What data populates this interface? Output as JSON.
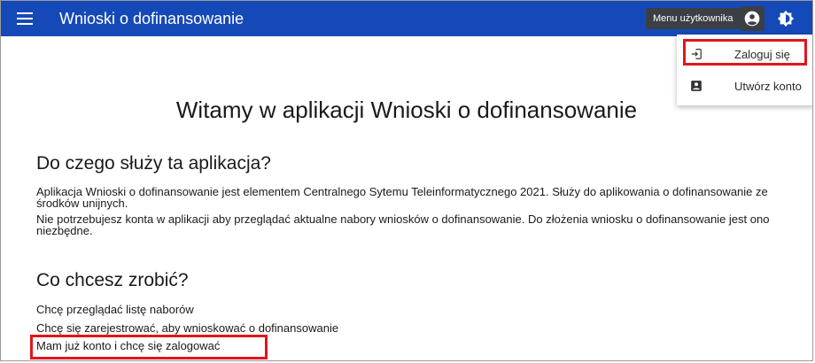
{
  "header": {
    "app_title": "Wnioski o dofinansowanie",
    "user_menu_label": "Menu użytkownika",
    "bar_color": "#1549b8"
  },
  "dropdown": {
    "items": [
      {
        "label": "Zaloguj się",
        "icon": "login-icon"
      },
      {
        "label": "Utwórz konto",
        "icon": "account-box-icon"
      }
    ]
  },
  "main": {
    "welcome": "Witamy w aplikacji Wnioski o dofinansowanie",
    "purpose_heading": "Do czego służy ta aplikacja?",
    "purpose_p1": "Aplikacja Wnioski o dofinansowanie jest elementem Centralnego Sytemu Teleinformatycznego 2021. Służy do aplikowania o dofinansowanie ze środków unijnych.",
    "purpose_p2": "Nie potrzebujesz konta w aplikacji aby przeglądać aktualne nabory wniosków o dofinansowanie. Do złożenia wniosku o dofinansowanie jest ono niezbędne.",
    "todo_heading": "Co chcesz zrobić?",
    "links": [
      "Chcę przeglądać listę naborów",
      "Chcę się zarejestrować, aby wnioskować o dofinansowanie",
      "Mam już konto i chcę się zalogować"
    ]
  },
  "highlight_color": "#e0161d"
}
